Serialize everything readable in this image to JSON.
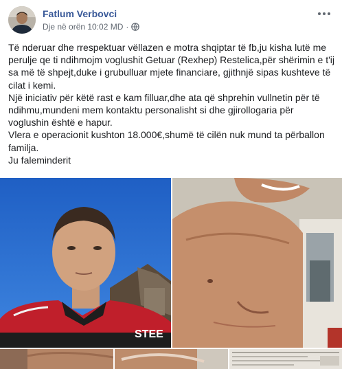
{
  "post": {
    "author": "Fatlum Verbovci",
    "timestamp": "Dje në orën 10:02 MD",
    "separator": "·",
    "privacy_icon": "globe-icon",
    "menu_icon": "more-options-icon",
    "paragraphs": [
      "Të nderuar dhe rrespektuar vëllazen e motra shqiptar të fb,ju kisha lutë me perulje qe ti ndihmojm voglushit Getuar (Rexhep) Restelica,për shërimin e t'ij sa më të shpejt,duke i grubulluar mjete financiare, gjithnjë sipas kushteve të cilat i kemi.",
      "Një iniciativ për këtë rast e kam filluar,dhe ata që shprehin vullnetin për të ndihmu,mundeni mem kontaktu personalisht si dhe gjirollogaria për voglushin është e hapur.",
      "Vlera e operacionit kushton 18.000€,shumë të cilën nuk mund ta përballon familja.",
      "Ju faleminderit"
    ]
  },
  "photos": {
    "photo1_shirt_text": "STEE"
  },
  "colors": {
    "author_link": "#385898",
    "meta_text": "#606770",
    "body_text": "#1c1e21"
  }
}
